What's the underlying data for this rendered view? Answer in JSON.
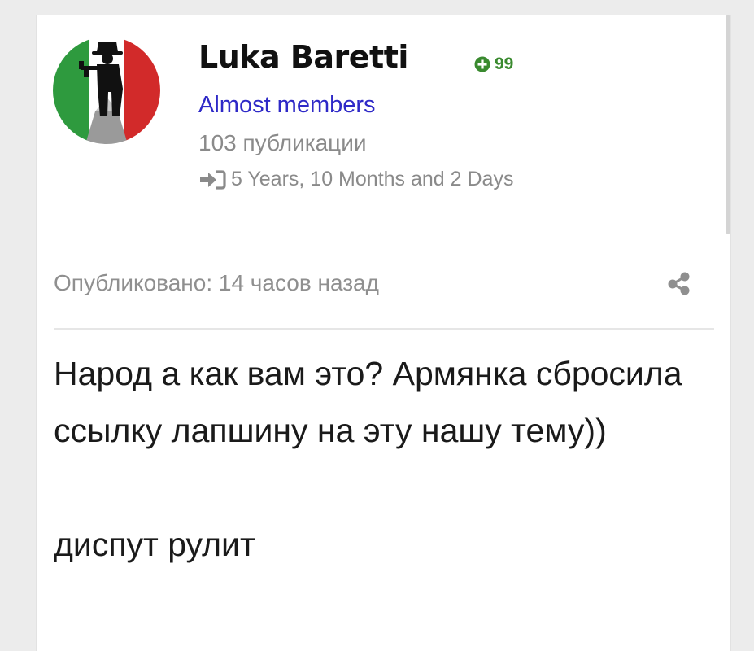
{
  "author": {
    "name": "Luka Baretti",
    "reputation": "99",
    "group": "Almost members",
    "post_count": "103 публикации",
    "member_since": "5 Years, 10 Months and 2 Days"
  },
  "post": {
    "date": "Опубликовано: 14 часов назад",
    "paragraphs": [
      "Народ а как вам это? Армянка сбросила ссылку лапшину на эту нашу тему))",
      "диспут рулит"
    ]
  },
  "colors": {
    "reputation_green": "#3a8a2f",
    "group_blue": "#2e29c7",
    "muted_gray": "#8a8a8a"
  }
}
